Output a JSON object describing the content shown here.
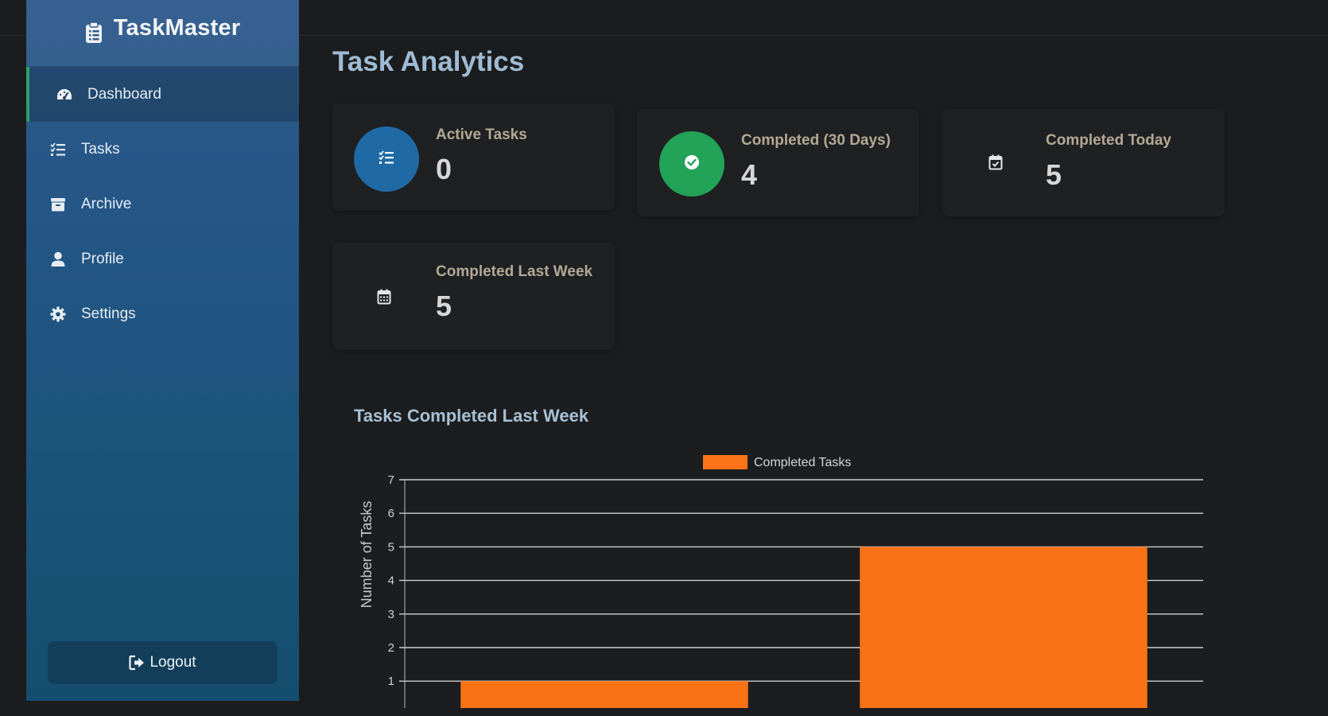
{
  "app": {
    "name": "TaskMaster"
  },
  "sidebar": {
    "items": [
      {
        "label": "Dashboard",
        "icon": "gauge-icon",
        "active": true
      },
      {
        "label": "Tasks",
        "icon": "list-check-icon",
        "active": false
      },
      {
        "label": "Archive",
        "icon": "archive-box-icon",
        "active": false
      },
      {
        "label": "Profile",
        "icon": "user-icon",
        "active": false
      },
      {
        "label": "Settings",
        "icon": "gear-icon",
        "active": false
      }
    ],
    "logout_label": "Logout"
  },
  "page": {
    "title": "Task Analytics"
  },
  "stats": [
    {
      "label": "Active Tasks",
      "value": "0",
      "icon": "list-check-icon",
      "color": "#1f6aa5"
    },
    {
      "label": "Completed (30 Days)",
      "value": "4",
      "icon": "check-circle-icon",
      "color": "#22a358"
    },
    {
      "label": "Completed Today",
      "value": "5",
      "icon": "calendar-check-icon",
      "color": ""
    },
    {
      "label": "Completed Last Week",
      "value": "5",
      "icon": "calendar-icon",
      "color": ""
    }
  ],
  "chart": {
    "title": "Tasks Completed Last Week"
  },
  "chart_data": {
    "type": "bar",
    "title": "Tasks Completed Last Week",
    "categories": [
      "",
      ""
    ],
    "series": [
      {
        "name": "Completed Tasks",
        "values": [
          1,
          5
        ],
        "color": "#f97316"
      }
    ],
    "xlabel": "",
    "ylabel": "Number of Tasks",
    "ylim": [
      0,
      7
    ],
    "yticks": [
      "1",
      "2",
      "3",
      "4",
      "5",
      "6",
      "7"
    ],
    "grid": true,
    "legend": "top-center"
  },
  "colors": {
    "accent_green": "#2aa36a",
    "bar_orange": "#f97316",
    "title_blue": "#9fbbd3"
  }
}
